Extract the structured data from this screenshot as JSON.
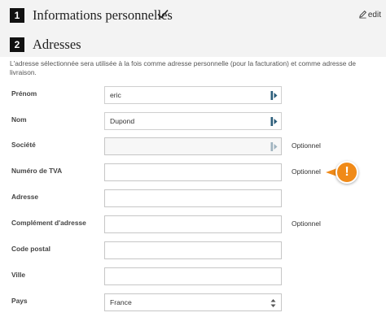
{
  "step1": {
    "number": "1",
    "title": "Informations personnelles",
    "edit_label": "edit"
  },
  "step2": {
    "number": "2",
    "title": "Adresses"
  },
  "intro": "L'adresse sélectionnée sera utilisée à la fois comme adresse personnelle (pour la facturation) et comme adresse de livraison.",
  "fields": {
    "firstname": {
      "label": "Prénom",
      "value": "eric"
    },
    "lastname": {
      "label": "Nom",
      "value": "Dupond"
    },
    "company": {
      "label": "Société",
      "value": "",
      "optional": "Optionnel"
    },
    "vat": {
      "label": "Numéro de TVA",
      "value": "",
      "optional": "Optionnel"
    },
    "address": {
      "label": "Adresse",
      "value": ""
    },
    "address2": {
      "label": "Complément d'adresse",
      "value": "",
      "optional": "Optionnel"
    },
    "postcode": {
      "label": "Code postal",
      "value": ""
    },
    "city": {
      "label": "Ville",
      "value": ""
    },
    "country": {
      "label": "Pays",
      "value": "France"
    }
  },
  "warning": {
    "symbol": "!",
    "color": "#f08a18"
  },
  "colors": {
    "header_bg": "#f3f3f3",
    "step_badge": "#111111",
    "accent": "#f08a18"
  }
}
